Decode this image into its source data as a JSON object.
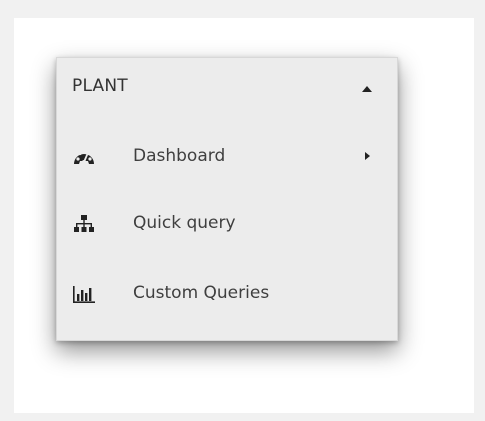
{
  "menu": {
    "header": {
      "label": "PLANT",
      "toggle_icon": "caret-up-icon"
    },
    "items": [
      {
        "label": "Dashboard",
        "icon": "dashboard-icon",
        "has_submenu": true
      },
      {
        "label": "Quick query",
        "icon": "sitemap-icon",
        "has_submenu": false
      },
      {
        "label": "Custom Queries",
        "icon": "bar-chart-icon",
        "has_submenu": false
      }
    ]
  },
  "colors": {
    "panel_background": "#ececec",
    "page_background": "#f1f1f1",
    "icon_color": "#222222"
  }
}
